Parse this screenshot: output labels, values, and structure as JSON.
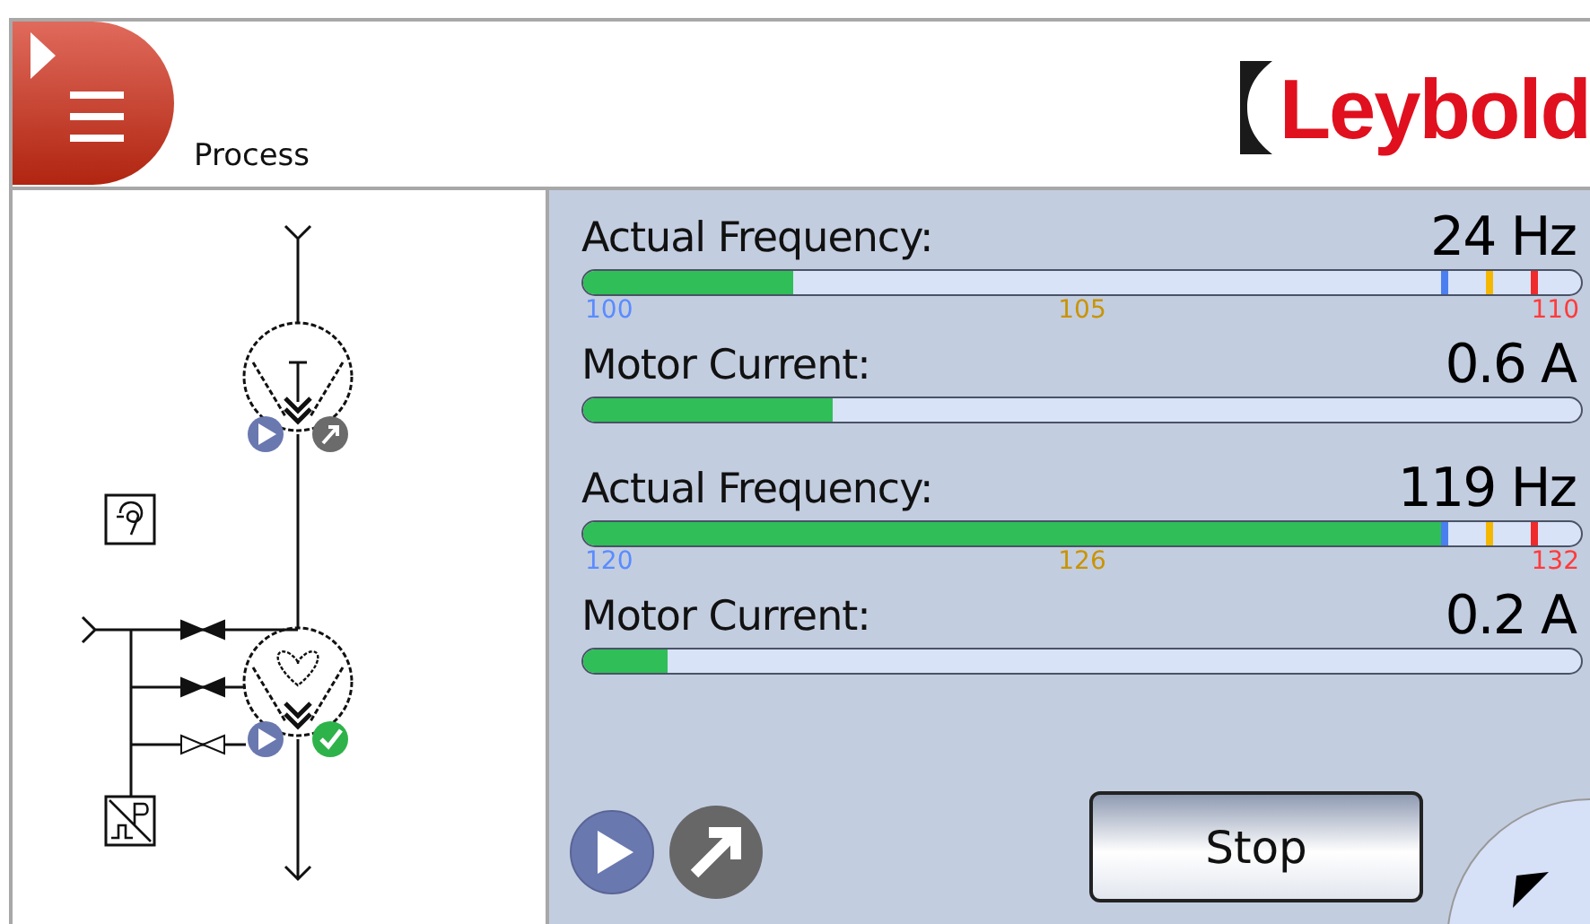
{
  "header": {
    "title": "Process",
    "logo": "Leybold"
  },
  "pumps": [
    {
      "frequency": {
        "label": "Actual Frequency:",
        "value": "24 Hz",
        "level": 0.21,
        "scale": [
          {
            "text": "100",
            "color": "#5a8cff"
          },
          {
            "text": "105",
            "color": "#c99400"
          },
          {
            "text": "110",
            "color": "#ff3b3b"
          }
        ]
      },
      "current": {
        "label": "Motor Current:",
        "value": "0.6 A",
        "level": 0.25
      }
    },
    {
      "frequency": {
        "label": "Actual Frequency:",
        "value": "119 Hz",
        "level": 0.865,
        "scale": [
          {
            "text": "120",
            "color": "#5a8cff"
          },
          {
            "text": "126",
            "color": "#c99400"
          },
          {
            "text": "132",
            "color": "#ff3b3b"
          }
        ]
      },
      "current": {
        "label": "Motor Current:",
        "value": "0.2 A",
        "level": 0.085
      }
    }
  ],
  "stop_button": "Stop"
}
